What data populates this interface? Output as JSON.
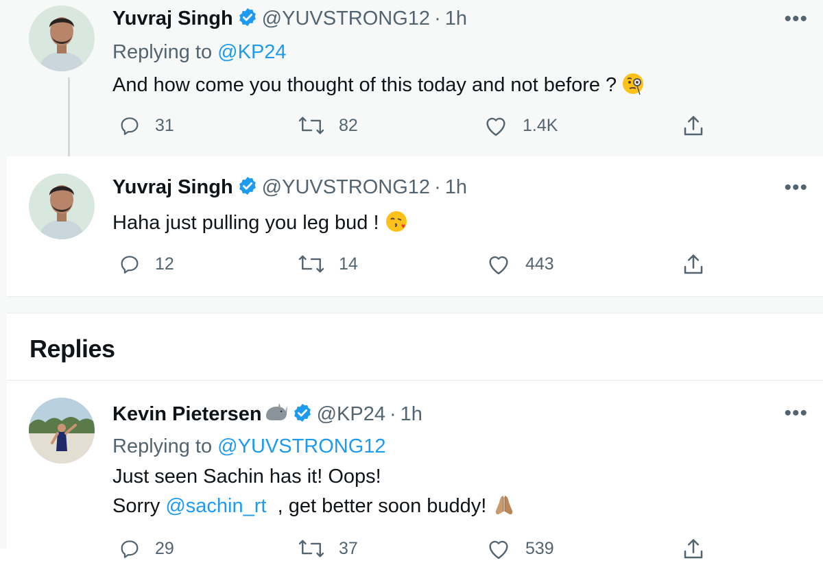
{
  "tweets": [
    {
      "name": "Yuvraj Singh",
      "handle": "@YUVSTRONG12",
      "time": "1h",
      "replying_prefix": "Replying to",
      "replying_to": "@KP24",
      "text": "And how come you thought of this today and not before ?",
      "emoji": "face-with-monocle",
      "replies": "31",
      "retweets": "82",
      "likes": "1.4K"
    },
    {
      "name": "Yuvraj Singh",
      "handle": "@YUVSTRONG12",
      "time": "1h",
      "text": "Haha just pulling you leg bud !",
      "emoji": "face-blowing-kiss",
      "replies": "12",
      "retweets": "14",
      "likes": "443"
    },
    {
      "name": "Kevin Pietersen",
      "name_emoji": "rhinoceros",
      "handle": "@KP24",
      "time": "1h",
      "replying_prefix": "Replying to",
      "replying_to": "@YUVSTRONG12",
      "text_line1": "Just seen Sachin has it! Oops!",
      "text_line2_prefix": "Sorry",
      "mention": "@sachin_rt",
      "text_line2_suffix": ", get better soon buddy!",
      "emoji": "folded-hands",
      "replies": "29",
      "retweets": "37",
      "likes": "539"
    }
  ],
  "separator": "·",
  "more_label": "•••",
  "replies_section_title": "Replies",
  "colors": {
    "link": "#1d9bf0",
    "secondary_text": "#536471",
    "primary_text": "#0f1419",
    "thread_bg": "#f7f9f9"
  }
}
